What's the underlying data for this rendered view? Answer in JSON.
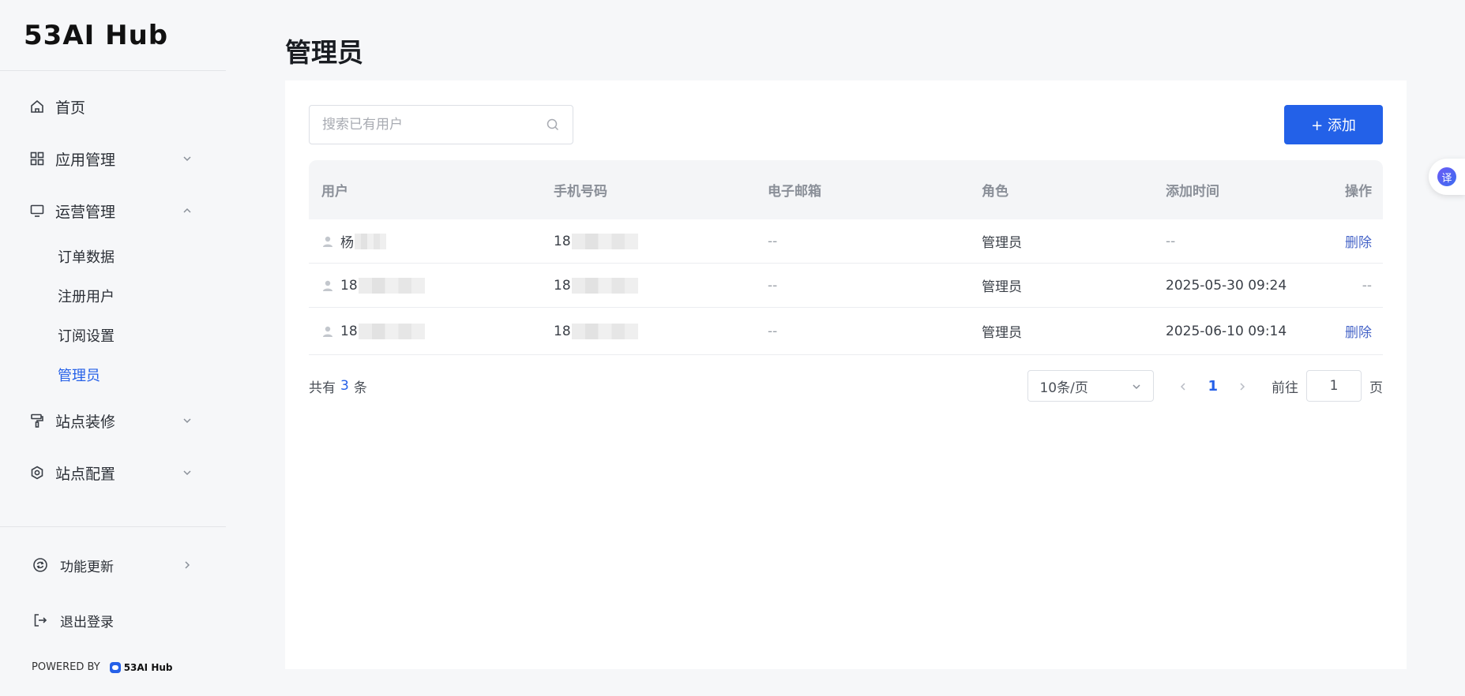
{
  "brand": {
    "name": "53AI Hub"
  },
  "sidebar": {
    "items": [
      {
        "label": "首页",
        "icon": "home-icon",
        "expandable": false
      },
      {
        "label": "应用管理",
        "icon": "apps-grid-icon",
        "expandable": true,
        "expanded": false
      },
      {
        "label": "运营管理",
        "icon": "monitor-icon",
        "expandable": true,
        "expanded": true,
        "children": [
          {
            "label": "订单数据",
            "active": false
          },
          {
            "label": "注册用户",
            "active": false
          },
          {
            "label": "订阅设置",
            "active": false
          },
          {
            "label": "管理员",
            "active": true
          }
        ]
      },
      {
        "label": "站点装修",
        "icon": "paint-roller-icon",
        "expandable": true,
        "expanded": false
      },
      {
        "label": "站点配置",
        "icon": "gear-icon",
        "expandable": true,
        "expanded": false
      }
    ],
    "bottom": [
      {
        "label": "功能更新",
        "icon": "refresh-circle-icon"
      },
      {
        "label": "退出登录",
        "icon": "logout-icon"
      }
    ],
    "powered_by": {
      "text": "POWERED BY",
      "logo_text": "53AI Hub"
    }
  },
  "main": {
    "title": "管理员",
    "search": {
      "placeholder": "搜索已有用户",
      "value": ""
    },
    "add_button": "+ 添加",
    "table": {
      "columns": [
        "用户",
        "手机号码",
        "电子邮箱",
        "角色",
        "添加时间",
        "操作"
      ],
      "rows": [
        {
          "user": "杨",
          "phone": "18",
          "email": "--",
          "role": "管理员",
          "time": "--",
          "action": "删除"
        },
        {
          "user": "18",
          "phone": "18",
          "email": "--",
          "role": "管理员",
          "time": "2025-05-30 09:24",
          "action": "--"
        },
        {
          "user": "18",
          "phone": "18",
          "email": "--",
          "role": "管理员",
          "time": "2025-06-10 09:14",
          "action": "删除"
        }
      ]
    },
    "pagination": {
      "total_prefix": "共有",
      "total": "3",
      "total_suffix": "条",
      "page_size": "10条/页",
      "current_page": "1",
      "goto_label": "前往",
      "goto_value": "1",
      "goto_suffix": "页"
    }
  },
  "translate_fab": {
    "label": "译"
  },
  "colors": {
    "accent": "#2361e8",
    "link": "#4866c8",
    "background": "#f6f7f9"
  }
}
